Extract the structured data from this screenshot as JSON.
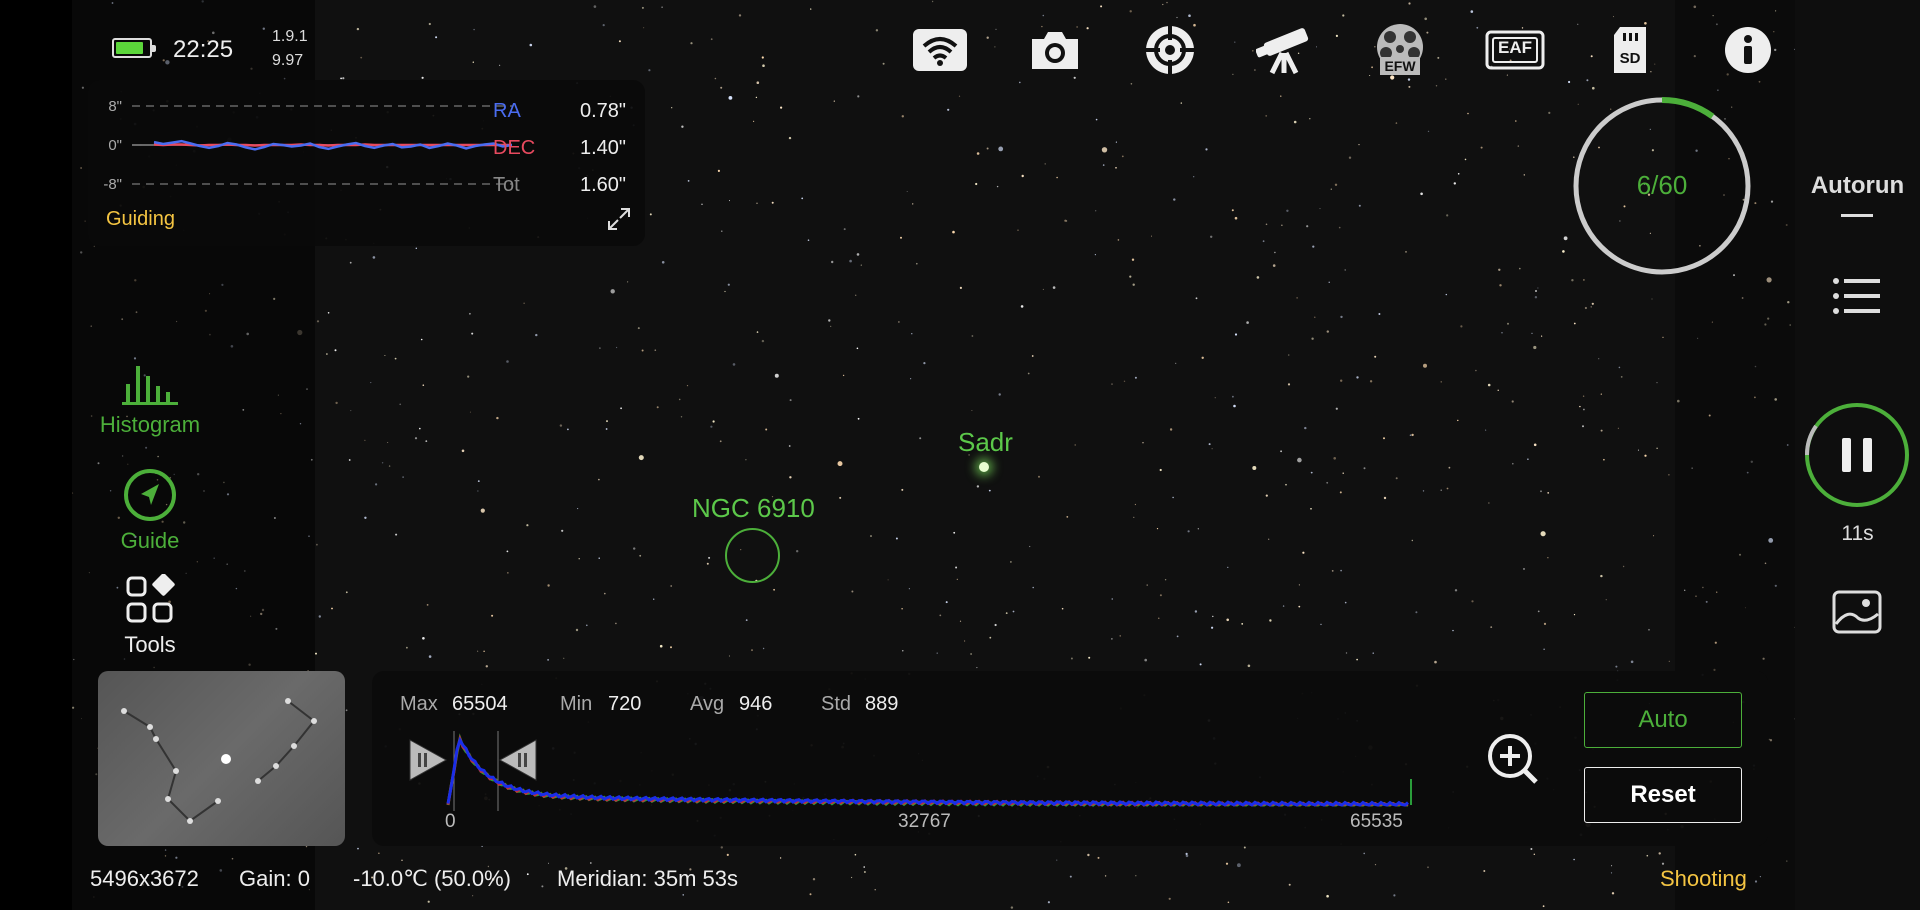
{
  "status": {
    "time": "22:25",
    "version_line1": "1.9.1",
    "version_line2": "9.97",
    "battery_level": 0.85
  },
  "top_icons": [
    "wifi-icon",
    "camera-icon",
    "focuser-icon",
    "telescope-icon",
    "filter-wheel-icon",
    "eaf-icon",
    "sd-card-icon",
    "info-icon"
  ],
  "top_icon_labels": {
    "efw": "EFW",
    "eaf": "EAF",
    "sd": "SD"
  },
  "guiding": {
    "y_labels": [
      "8\"",
      "0\"",
      "-8\""
    ],
    "ra_label": "RA",
    "ra_value": "0.78\"",
    "dec_label": "DEC",
    "dec_value": "1.40\"",
    "tot_label": "Tot",
    "tot_value": "1.60\"",
    "title": "Guiding",
    "ra_trace": [
      0.6,
      0.2,
      0.5,
      0.8,
      0.3,
      -0.2,
      -0.6,
      -0.2,
      0.4,
      0.1,
      -0.5,
      -0.9,
      -0.4,
      0.2,
      0.0,
      -0.3,
      -0.1,
      0.3,
      -0.4,
      -0.8,
      -0.3,
      0.1,
      0.4,
      -0.2,
      -0.6,
      -0.1,
      0.2,
      -0.5,
      -0.3,
      0.1,
      -0.6,
      -0.2,
      0.3,
      -0.1,
      -0.7,
      -0.2,
      0.1,
      0.3,
      -0.3,
      0.0
    ],
    "dec_trace": [
      0.1,
      0.0,
      0.1,
      0.1,
      0.0,
      -0.1,
      0.0,
      0.0,
      0.1,
      0.0,
      0.0,
      -0.1,
      0.0,
      0.0,
      0.0,
      0.0,
      0.1,
      0.0,
      0.0,
      -0.1,
      0.0,
      0.0,
      0.0,
      0.1,
      0.0,
      0.0,
      0.0,
      0.0,
      0.0,
      0.0,
      0.0,
      0.0,
      0.0,
      0.0,
      0.0,
      0.0,
      0.0,
      0.0,
      0.0,
      0.0
    ],
    "colors": {
      "ra": "#4a6cf0",
      "dec": "#e84a5f"
    }
  },
  "tools": {
    "histogram_label": "Histogram",
    "guide_label": "Guide",
    "tools_label": "Tools"
  },
  "sky_labels": {
    "sadr": "Sadr",
    "ngc": "NGC 6910"
  },
  "histogram": {
    "max_label": "Max",
    "max_value": "65504",
    "min_label": "Min",
    "min_value": "720",
    "avg_label": "Avg",
    "avg_value": "946",
    "std_label": "Std",
    "std_value": "889",
    "axis_0": "0",
    "axis_mid": "32767",
    "axis_max": "65535",
    "auto_label": "Auto",
    "reset_label": "Reset"
  },
  "bottom": {
    "resolution": "5496x3672",
    "gain": "Gain: 0",
    "temp": "-10.0℃ (50.0%)",
    "meridian": "Meridian: 35m 53s",
    "state": "Shooting"
  },
  "sequence": {
    "progress_text": "6/60",
    "progress_fraction": 0.1
  },
  "right": {
    "autorun_label": "Autorun",
    "countdown": "11s"
  },
  "accent": "#4caf3a",
  "warning_color": "#f5c542"
}
